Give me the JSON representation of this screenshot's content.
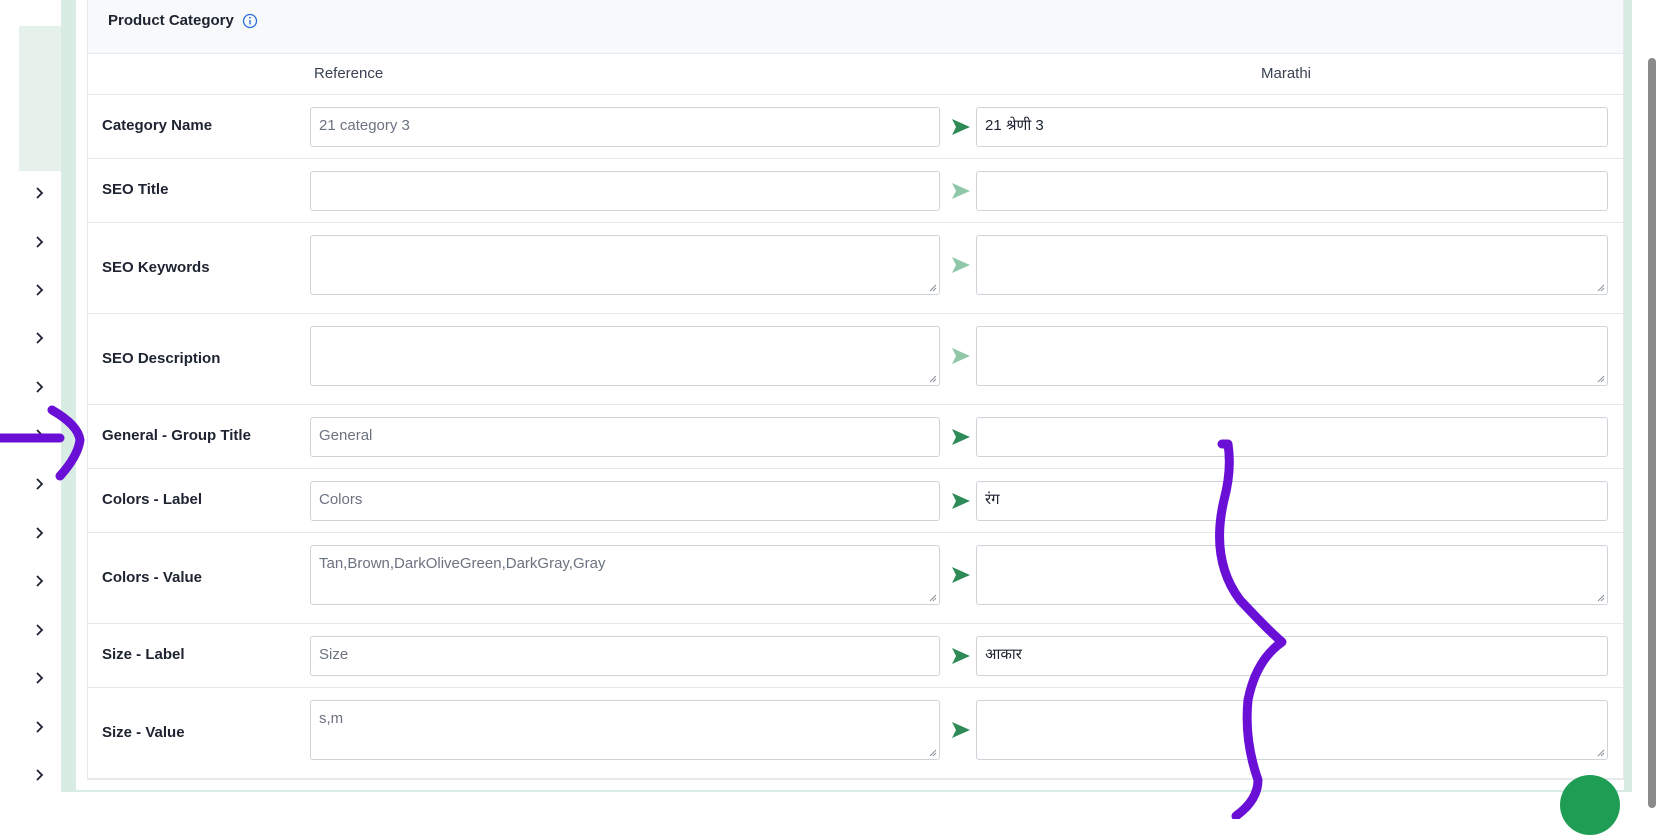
{
  "card": {
    "title": "Product Category",
    "info_icon": "info-circle-icon"
  },
  "columns": {
    "reference": "Reference",
    "target": "Marathi"
  },
  "rows": [
    {
      "label": "Category Name",
      "reference": "21 category 3",
      "target": "21 श्रेणी 3",
      "multiline": false
    },
    {
      "label": "SEO Title",
      "reference": "",
      "target": "",
      "multiline": false
    },
    {
      "label": "SEO Keywords",
      "reference": "",
      "target": "",
      "multiline": true
    },
    {
      "label": "SEO Description",
      "reference": "",
      "target": "",
      "multiline": true
    },
    {
      "label": "General - Group Title",
      "reference": "General",
      "target": "",
      "multiline": false
    },
    {
      "label": "Colors - Label",
      "reference": "Colors",
      "target": "रंग",
      "multiline": false
    },
    {
      "label": "Colors - Value",
      "reference": "Tan,Brown,DarkOliveGreen,DarkGray,Gray",
      "target": "",
      "multiline": true
    },
    {
      "label": "Size - Label",
      "reference": "Size",
      "target": "आकार",
      "multiline": false
    },
    {
      "label": "Size - Value",
      "reference": "s,m",
      "target": "",
      "multiline": true
    }
  ],
  "icons": {
    "translate": "send-arrow-icon",
    "sidebar_expand": "chevron-right-icon"
  },
  "colors": {
    "send_active": "#2e8b57",
    "send_inactive": "#8fc7a8",
    "annotation": "#6a0fd6",
    "frame": "#d9ece4"
  }
}
